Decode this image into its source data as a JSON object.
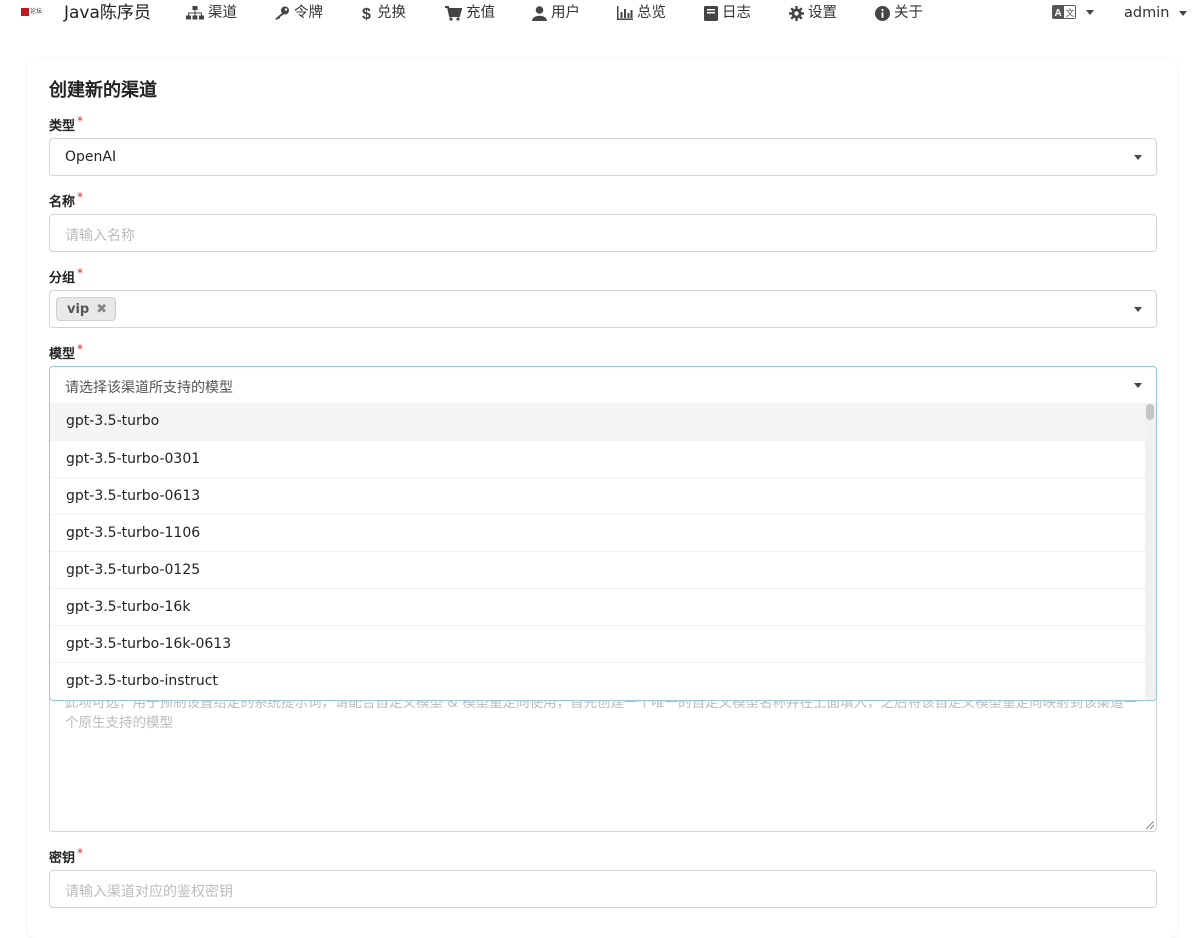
{
  "brand": {
    "logo_text": "Java陈序员",
    "logo_mark_text": "论坛"
  },
  "nav": {
    "items": [
      {
        "key": "channel",
        "label": "渠道",
        "icon": "sitemap-icon"
      },
      {
        "key": "token",
        "label": "令牌",
        "icon": "key-icon"
      },
      {
        "key": "redeem",
        "label": "兑换",
        "icon": "dollar-icon"
      },
      {
        "key": "topup",
        "label": "充值",
        "icon": "cart-icon"
      },
      {
        "key": "user",
        "label": "用户",
        "icon": "user-icon"
      },
      {
        "key": "dashboard",
        "label": "总览",
        "icon": "bar-chart-icon"
      },
      {
        "key": "log",
        "label": "日志",
        "icon": "book-icon"
      },
      {
        "key": "setting",
        "label": "设置",
        "icon": "gear-icon"
      },
      {
        "key": "about",
        "label": "关于",
        "icon": "info-icon"
      }
    ],
    "language_icon": "translate-icon",
    "user": "admin"
  },
  "form": {
    "title": "创建新的渠道",
    "required_mark": "*",
    "type": {
      "label": "类型",
      "value": "OpenAI"
    },
    "name": {
      "label": "名称",
      "placeholder": "请输入名称"
    },
    "group": {
      "label": "分组",
      "tags": [
        "vip"
      ],
      "remove_glyph": "✖"
    },
    "models": {
      "label": "模型",
      "placeholder": "请选择该渠道所支持的模型",
      "options": [
        "gpt-3.5-turbo",
        "gpt-3.5-turbo-0301",
        "gpt-3.5-turbo-0613",
        "gpt-3.5-turbo-1106",
        "gpt-3.5-turbo-0125",
        "gpt-3.5-turbo-16k",
        "gpt-3.5-turbo-16k-0613",
        "gpt-3.5-turbo-instruct"
      ]
    },
    "model_mapping": {
      "placeholder": "此项可选，用于预制设置给定的系统提示词，请配合自定义模型 & 模型重定向使用，首先创建一个唯一的自定义模型名称并在上面填入，之后将该自定义模型重定向映射到该渠道一个原生支持的模型"
    },
    "key": {
      "label": "密钥",
      "placeholder": "请输入渠道对应的鉴权密钥"
    }
  },
  "colors": {
    "required": "#db2828",
    "focus_border": "#96c8da",
    "logo_red": "#c0181f"
  }
}
